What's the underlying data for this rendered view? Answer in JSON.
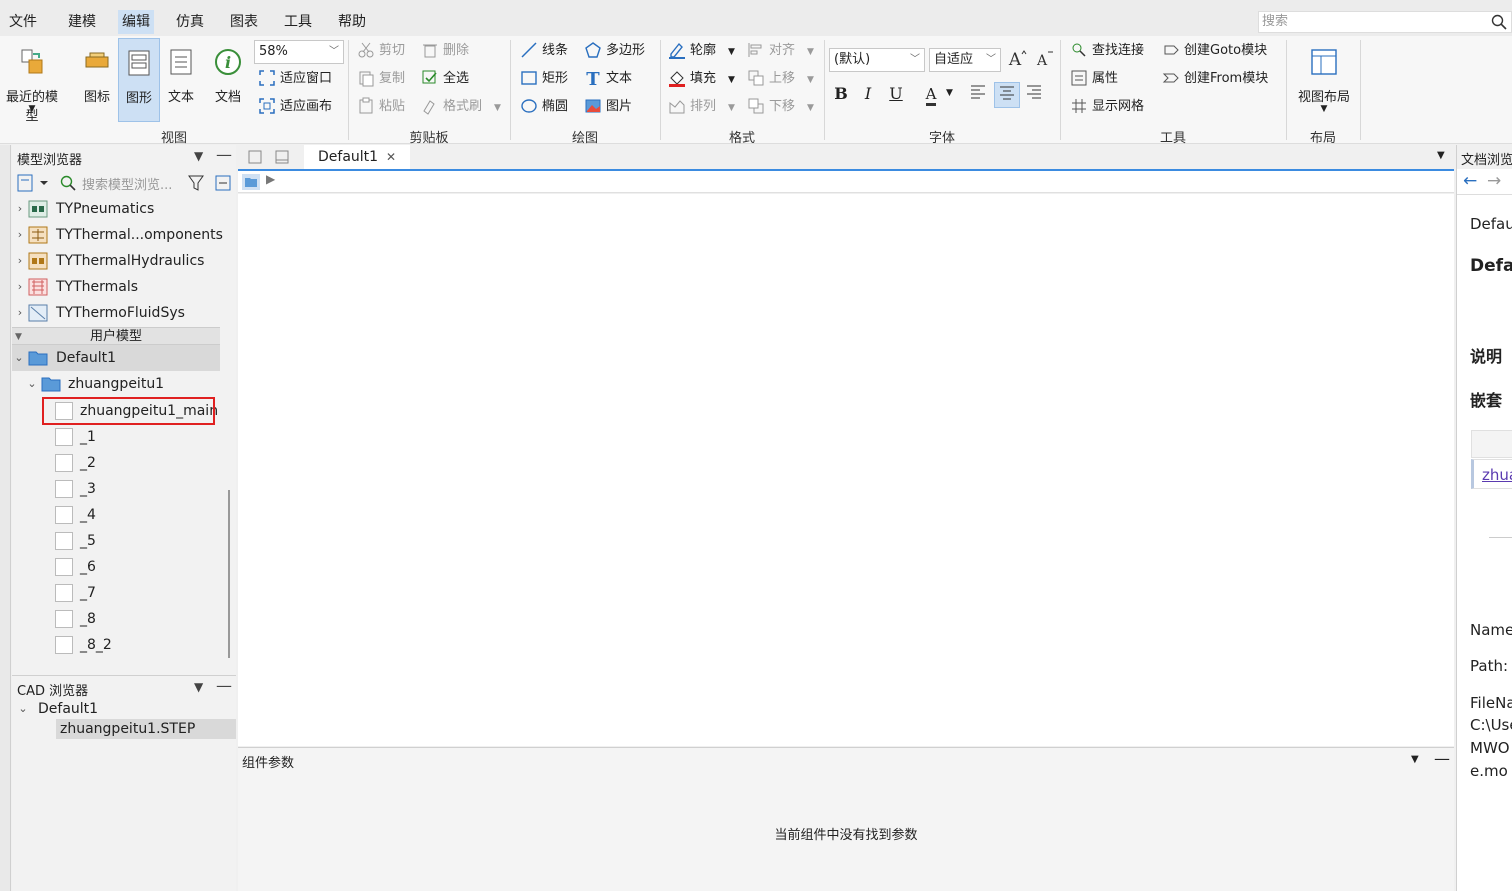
{
  "menu": {
    "items": [
      "文件",
      "建模",
      "编辑",
      "仿真",
      "图表",
      "工具",
      "帮助"
    ],
    "active_index": 2,
    "search_placeholder": "搜索"
  },
  "ribbon": {
    "view": {
      "group_label": "视图",
      "recent_models": "最近的模型",
      "icon_btn": "图标",
      "graphic_btn": "图形",
      "text_btn": "文本",
      "doc_btn": "文档",
      "zoom_value": "58%",
      "fit_window": "适应窗口",
      "fit_canvas": "适应画布"
    },
    "clipboard": {
      "group_label": "剪贴板",
      "cut": "剪切",
      "delete": "删除",
      "copy": "复制",
      "select_all": "全选",
      "paste": "粘贴",
      "format_painter": "格式刷"
    },
    "draw": {
      "group_label": "绘图",
      "line": "线条",
      "polygon": "多边形",
      "rect": "矩形",
      "text": "文本",
      "ellipse": "椭圆",
      "image": "图片"
    },
    "format": {
      "group_label": "格式",
      "outline": "轮廓",
      "align": "对齐",
      "fill": "填充",
      "move_up": "上移",
      "arrange": "排列",
      "move_down": "下移"
    },
    "font": {
      "group_label": "字体",
      "font_value": "(默认)",
      "size_value": "自适应",
      "bold": "B",
      "italic": "I",
      "underline": "U",
      "color_glyph": "A"
    },
    "tools": {
      "group_label": "工具",
      "find_connection": "查找连接",
      "create_goto": "创建Goto模块",
      "properties": "属性",
      "create_from": "创建From模块",
      "show_grid": "显示网格"
    },
    "layout": {
      "group_label": "布局",
      "view_layout": "视图布局"
    }
  },
  "model_browser": {
    "title": "模型浏览器",
    "search_placeholder": "搜索模型浏览...",
    "libraries": [
      "TYPneumatics",
      "TYThermal...omponents",
      "TYThermalHydraulics",
      "TYThermals",
      "TYThermoFluidSys"
    ],
    "user_models_label": "用户模型",
    "root": "Default1",
    "child": "zhuangpeitu1",
    "items": [
      "zhuangpeitu1_main",
      "_1",
      "_2",
      "_3",
      "_4",
      "_5",
      "_6",
      "_7",
      "_8",
      "_8_2"
    ]
  },
  "cad_browser": {
    "title": "CAD 浏览器",
    "root": "Default1",
    "file": "zhuangpeitu1.STEP"
  },
  "editor": {
    "tab_label": "Default1",
    "params_title": "组件参数",
    "params_empty": "当前组件中没有找到参数"
  },
  "doc_panel": {
    "title": "文档浏览",
    "lines": [
      "Defau",
      "Defa",
      "说明",
      "嵌套",
      "zhua",
      "Name",
      "Path: l",
      "FileNa",
      "C:\\Use",
      "MWO",
      "e.mo"
    ]
  },
  "colors": {
    "accent": "#3b8be0",
    "highlight_border": "#e02020",
    "selected_bg": "#cde0f4"
  }
}
